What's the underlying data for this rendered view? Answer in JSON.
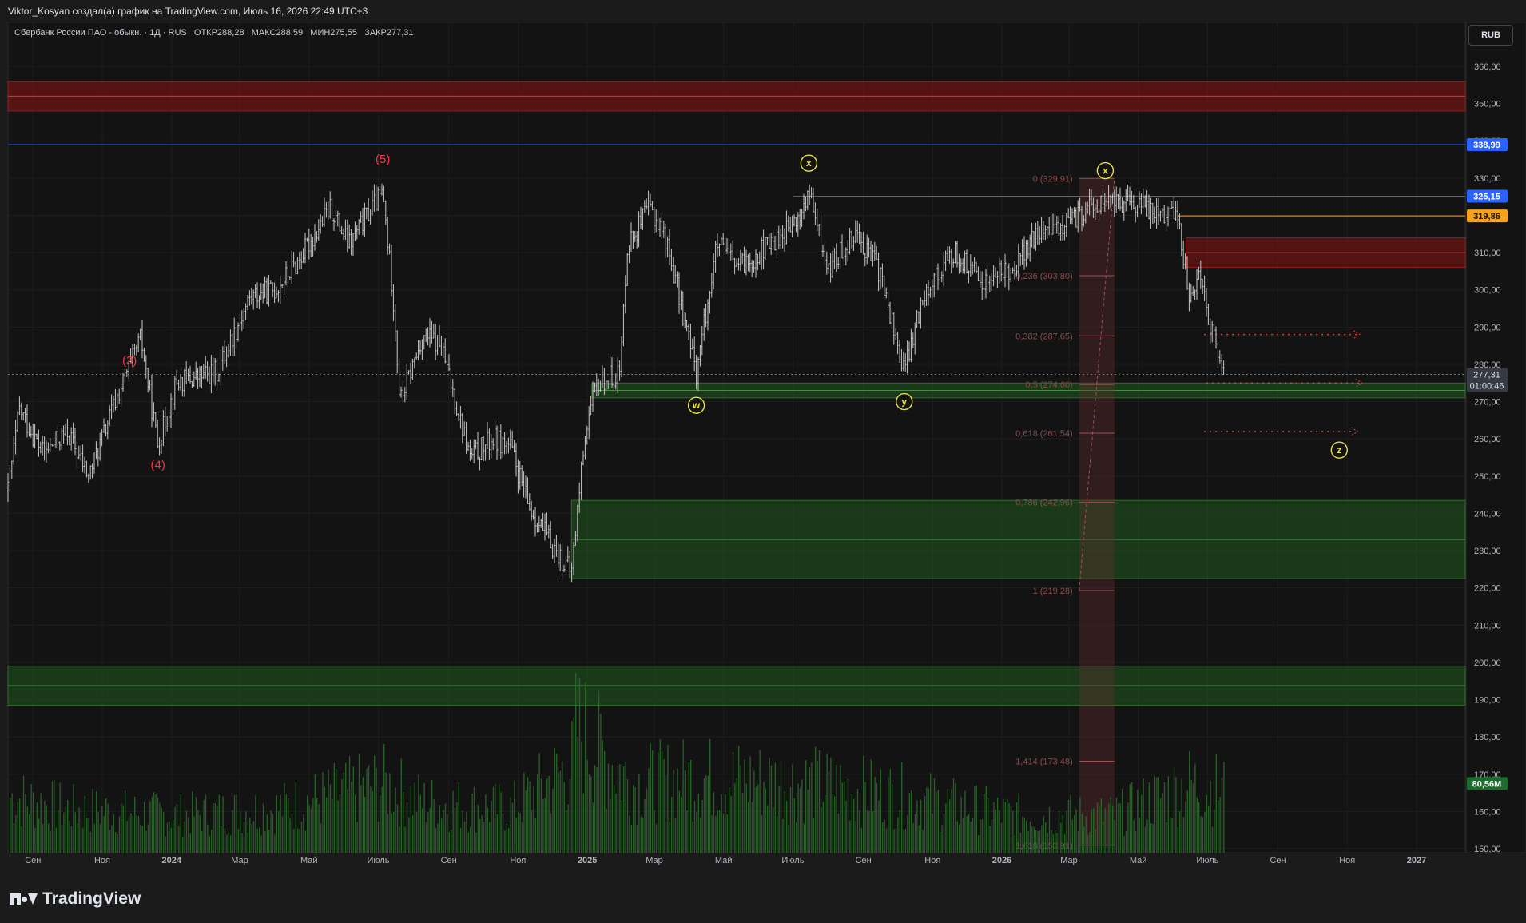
{
  "header": {
    "attribution": "Viktor_Kosyan создал(а) график на TradingView.com, Июль 16, 2026 22:49 UTC+3"
  },
  "legend": {
    "symbol": "Сбербанк России ПАО - обыкн. · 1Д · RUS",
    "open": "ОТКР288,28",
    "high": "МАКС288,59",
    "low": "МИН275,55",
    "close": "ЗАКР277,31"
  },
  "currency_button": "RUB",
  "footer": {
    "brand": "TradingView"
  },
  "colors": {
    "background": "#131313",
    "grid": "#1e1e1e",
    "bar": "#c8c8c8",
    "volume": "#2b6b2b",
    "resistance_zone": "#6b1414",
    "support_zone": "#1f5a1f",
    "fib_text": "#8a4a4a",
    "wave_red": "#f23645",
    "wave_yellow": "#e8e34a",
    "blue_line": "#2962ff",
    "orange_line": "#f7a21b"
  },
  "chart_data": {
    "type": "bar",
    "title": "Сбербанк России ПАО - обыкн.",
    "interval": "1Д",
    "currency": "RUB",
    "ylim": [
      150,
      365
    ],
    "y_ticks": [
      "360,00",
      "350,00",
      "340,00",
      "330,00",
      "320,00",
      "310,00",
      "300,00",
      "290,00",
      "280,00",
      "270,00",
      "260,00",
      "250,00",
      "240,00",
      "230,00",
      "220,00",
      "210,00",
      "200,00",
      "190,00",
      "180,00",
      "170,00",
      "160,00",
      "150,00"
    ],
    "x_ticks": [
      "Сен",
      "Ноя",
      "2024",
      "Мар",
      "Май",
      "Июль",
      "Сен",
      "Ноя",
      "2025",
      "Мар",
      "Май",
      "Июль",
      "Сен",
      "Ноя",
      "2026",
      "Мар",
      "Май",
      "Июль",
      "Сен",
      "Ноя",
      "2027"
    ],
    "x_range": [
      "2023-08-10",
      "2027-01-20"
    ],
    "price_series": [
      [
        "2023-08-10",
        246
      ],
      [
        "2023-08-20",
        268
      ],
      [
        "2023-09-10",
        256
      ],
      [
        "2023-10-01",
        262
      ],
      [
        "2023-10-20",
        250
      ],
      [
        "2023-11-10",
        268
      ],
      [
        "2023-12-05",
        287
      ],
      [
        "2023-12-20",
        258
      ],
      [
        "2024-01-05",
        275
      ],
      [
        "2024-02-10",
        278
      ],
      [
        "2024-03-10",
        298
      ],
      [
        "2024-04-01",
        300
      ],
      [
        "2024-04-20",
        307
      ],
      [
        "2024-05-20",
        322
      ],
      [
        "2024-06-05",
        312
      ],
      [
        "2024-06-25",
        322
      ],
      [
        "2024-07-05",
        326
      ],
      [
        "2024-07-15",
        295
      ],
      [
        "2024-07-20",
        270
      ],
      [
        "2024-08-10",
        288
      ],
      [
        "2024-08-25",
        285
      ],
      [
        "2024-09-20",
        255
      ],
      [
        "2024-10-10",
        260
      ],
      [
        "2024-10-25",
        258
      ],
      [
        "2024-11-10",
        242
      ],
      [
        "2024-11-30",
        232
      ],
      [
        "2024-12-18",
        224
      ],
      [
        "2024-12-30",
        262
      ],
      [
        "2025-01-10",
        275
      ],
      [
        "2025-01-30",
        278
      ],
      [
        "2025-02-05",
        312
      ],
      [
        "2025-02-25",
        322
      ],
      [
        "2025-03-10",
        315
      ],
      [
        "2025-04-07",
        278
      ],
      [
        "2025-04-25",
        312
      ],
      [
        "2025-05-15",
        306
      ],
      [
        "2025-06-10",
        312
      ],
      [
        "2025-07-05",
        318
      ],
      [
        "2025-07-15",
        326
      ],
      [
        "2025-08-01",
        305
      ],
      [
        "2025-08-25",
        316
      ],
      [
        "2025-09-15",
        305
      ],
      [
        "2025-10-07",
        278
      ],
      [
        "2025-10-25",
        300
      ],
      [
        "2025-11-20",
        310
      ],
      [
        "2025-12-15",
        302
      ],
      [
        "2026-01-10",
        306
      ],
      [
        "2026-02-05",
        316
      ],
      [
        "2026-03-01",
        318
      ],
      [
        "2026-03-20",
        322
      ],
      [
        "2026-04-10",
        324
      ],
      [
        "2026-05-10",
        322
      ],
      [
        "2026-06-05",
        320
      ],
      [
        "2026-06-15",
        298
      ],
      [
        "2026-06-25",
        305
      ],
      [
        "2026-07-05",
        288
      ],
      [
        "2026-07-16",
        277.31
      ]
    ],
    "volume_series": [
      [
        "2023-08-10",
        0.45
      ],
      [
        "2023-10-01",
        0.35
      ],
      [
        "2024-01-05",
        0.3
      ],
      [
        "2024-04-01",
        0.35
      ],
      [
        "2024-07-05",
        0.55
      ],
      [
        "2024-08-10",
        0.4
      ],
      [
        "2024-10-25",
        0.35
      ],
      [
        "2024-12-18",
        0.7
      ],
      [
        "2024-12-22",
        1.0
      ],
      [
        "2025-02-10",
        0.55
      ],
      [
        "2025-04-07",
        0.6
      ],
      [
        "2025-07-15",
        0.55
      ],
      [
        "2025-10-07",
        0.45
      ],
      [
        "2026-01-10",
        0.3
      ],
      [
        "2026-04-10",
        0.3
      ],
      [
        "2026-06-15",
        0.55
      ],
      [
        "2026-07-16",
        0.5
      ]
    ],
    "zones": [
      {
        "kind": "resistance",
        "from": 348,
        "to": 356,
        "start": "2023-08-10"
      },
      {
        "kind": "resistance",
        "from": 306,
        "to": 314,
        "start": "2026-06-12"
      },
      {
        "kind": "support",
        "from": 271,
        "to": 275,
        "start": "2025-01-05"
      },
      {
        "kind": "support",
        "from": 222.5,
        "to": 243.5,
        "start": "2024-12-18"
      },
      {
        "kind": "support",
        "from": 188.5,
        "to": 199,
        "start": "2023-08-10"
      }
    ],
    "horizontal_lines": [
      {
        "label": "338,99",
        "value": 338.99,
        "color": "#2962ff",
        "start": "2023-08-10"
      },
      {
        "label": "325,15",
        "value": 325.15,
        "color": "#2962ff",
        "start": "2025-07-01"
      },
      {
        "label": "319,86",
        "value": 319.86,
        "color": "#f7a21b",
        "start": "2026-06-05"
      }
    ],
    "fibonacci": {
      "start": "2026-03-10",
      "end": "2026-04-10",
      "levels": [
        {
          "label": "0 (329,91)",
          "value": 329.91
        },
        {
          "label": "0,236 (303,80)",
          "value": 303.8
        },
        {
          "label": "0,382 (287,65)",
          "value": 287.65
        },
        {
          "label": "0,5 (274,60)",
          "value": 274.6
        },
        {
          "label": "0,618 (261,54)",
          "value": 261.54
        },
        {
          "label": "0,786 (242,96)",
          "value": 242.96
        },
        {
          "label": "1 (219,28)",
          "value": 219.28
        },
        {
          "label": "1,414 (173,48)",
          "value": 173.48
        },
        {
          "label": "1,618 (150,91)",
          "value": 150.91
        }
      ]
    },
    "projection_lines": [
      {
        "value": 288,
        "start": "2026-06-28",
        "end": "2026-11-10"
      },
      {
        "value": 275,
        "start": "2026-06-30",
        "end": "2026-11-12"
      },
      {
        "value": 262,
        "start": "2026-06-28",
        "end": "2026-11-08"
      }
    ],
    "wave_labels": [
      {
        "text": "(3)",
        "date": "2023-11-25",
        "value": 280,
        "style": "red"
      },
      {
        "text": "(4)",
        "date": "2023-12-20",
        "value": 252,
        "style": "red"
      },
      {
        "text": "(5)",
        "date": "2024-07-05",
        "value": 334,
        "style": "red"
      },
      {
        "text": "x",
        "date": "2025-07-15",
        "value": 334,
        "style": "circle"
      },
      {
        "text": "w",
        "date": "2025-04-07",
        "value": 269,
        "style": "circle"
      },
      {
        "text": "y",
        "date": "2025-10-07",
        "value": 270,
        "style": "circle"
      },
      {
        "text": "x",
        "date": "2026-04-02",
        "value": 332,
        "style": "circle"
      },
      {
        "text": "z",
        "date": "2026-10-25",
        "value": 257,
        "style": "circle"
      }
    ],
    "price_labels": [
      {
        "text": "338,99",
        "value": 338.99,
        "bg": "#2962ff",
        "fg": "#ffffff"
      },
      {
        "text": "325,15",
        "value": 325.15,
        "bg": "#2962ff",
        "fg": "#ffffff"
      },
      {
        "text": "319,86",
        "value": 319.86,
        "bg": "#f7a21b",
        "fg": "#131313"
      },
      {
        "text": "277,31",
        "sub": "01:00:46",
        "value": 277.31,
        "bg": "#363a45",
        "fg": "#e0e3eb"
      },
      {
        "text": "80,56M",
        "value": 167.5,
        "bg": "#1e6b2e",
        "fg": "#ffffff"
      }
    ]
  }
}
